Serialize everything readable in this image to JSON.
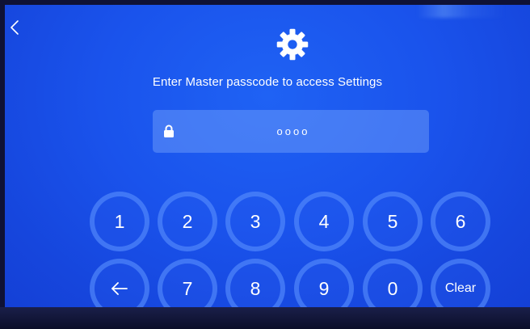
{
  "screen": {
    "title": "Enter Master passcode to access Settings",
    "icons": {
      "back": "chevron-left-icon",
      "header": "gear-icon",
      "field": "lock-icon",
      "backspace": "arrow-left-icon"
    }
  },
  "passcode_field": {
    "masked_value": "oooo",
    "length": 4
  },
  "keypad": {
    "row1": [
      "1",
      "2",
      "3",
      "4",
      "5",
      "6"
    ],
    "row2_digits": [
      "7",
      "8",
      "9",
      "0"
    ],
    "clear_label": "Clear"
  },
  "colors": {
    "background": "#1a53ec",
    "key_ring": "#5f96ff",
    "text": "#ffffff"
  }
}
